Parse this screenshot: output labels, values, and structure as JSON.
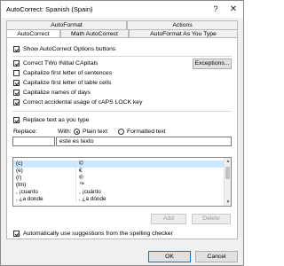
{
  "window": {
    "title": "AutoCorrect: Spanish (Spain)",
    "help_glyph": "?",
    "close_glyph": "✕"
  },
  "tabs_top": [
    {
      "label": "AutoFormat"
    },
    {
      "label": "Actions"
    }
  ],
  "tabs_bottom": [
    {
      "label": "AutoCorrect",
      "active": true
    },
    {
      "label": "Math AutoCorrect",
      "active": false
    },
    {
      "label": "AutoFormat As You Type",
      "active": false
    }
  ],
  "options": {
    "show_buttons": {
      "label": "Show AutoCorrect Options buttons",
      "checked": true
    },
    "two_initials": {
      "label": "Correct TWo INitial CApitals",
      "checked": true
    },
    "first_sentence": {
      "label": "Capitalize first letter of sentences",
      "checked": false
    },
    "first_table": {
      "label": "Capitalize first letter of table cells",
      "checked": true
    },
    "names_days": {
      "label": "Capitalize names of days",
      "checked": true
    },
    "caps_lock": {
      "label": "Correct accidental usage of cAPS LOCK key",
      "checked": true
    },
    "replace_as_type": {
      "label": "Replace text as you type",
      "checked": true
    },
    "auto_suggest": {
      "label": "Automatically use suggestions from the spelling checker",
      "checked": true
    }
  },
  "exceptions_button": "Exceptions...",
  "replace": {
    "replace_label": "Replace:",
    "with_label": "With:",
    "plain_text": {
      "label": "Plain text",
      "selected": true
    },
    "formatted_text": {
      "label": "Formatted text",
      "selected": false
    },
    "replace_value": "",
    "with_value": "este es texto"
  },
  "entries": [
    {
      "replace": "(c)",
      "with": "©",
      "selected": true
    },
    {
      "replace": "(e)",
      "with": "€",
      "selected": false
    },
    {
      "replace": "(r)",
      "with": "®",
      "selected": false
    },
    {
      "replace": "(tm)",
      "with": "™",
      "selected": false
    },
    {
      "replace": ", ¡cuanto",
      "with": ", ¡cuánto",
      "selected": false
    },
    {
      "replace": ", ¿a donde",
      "with": ", ¿a dónde",
      "selected": false
    }
  ],
  "buttons": {
    "add": "Add",
    "delete": "Delete",
    "ok": "OK",
    "cancel": "Cancel"
  },
  "icons": {
    "scroll_up": "▲",
    "scroll_down": "▼"
  }
}
